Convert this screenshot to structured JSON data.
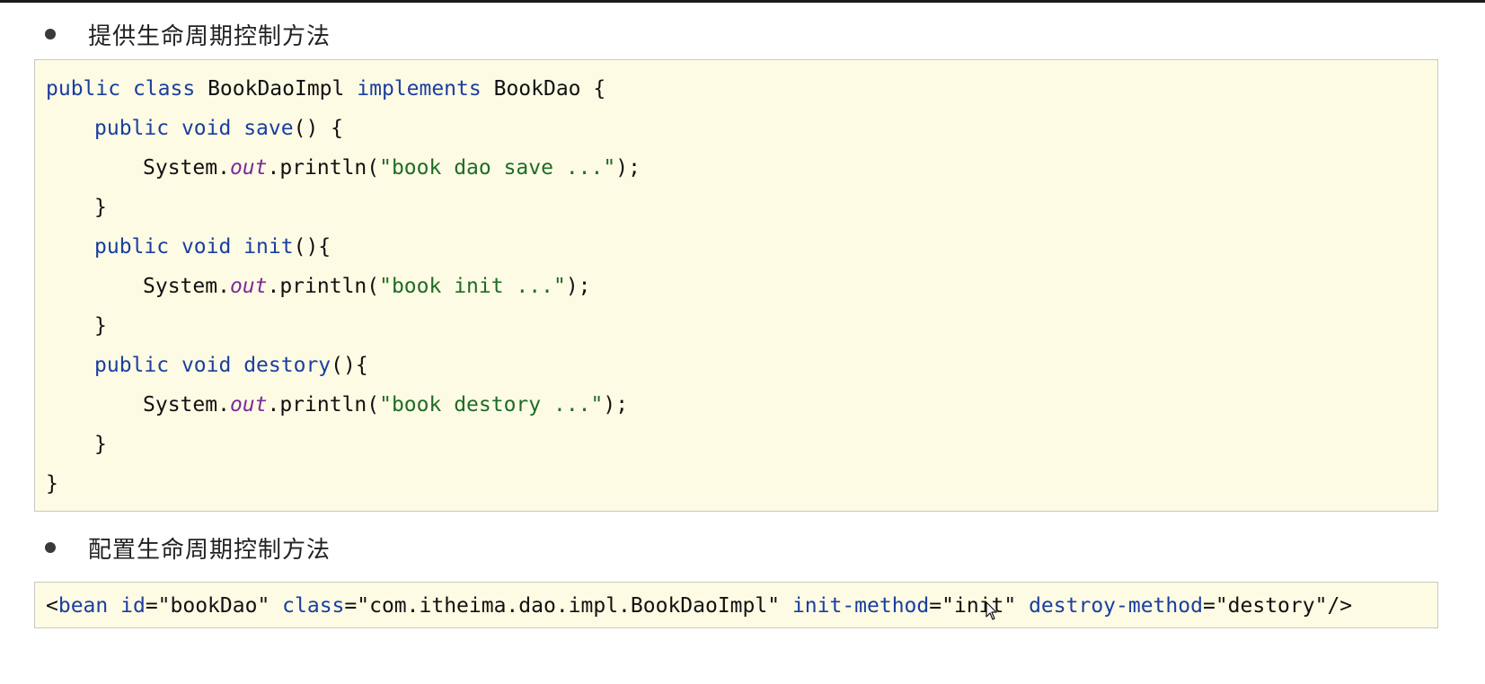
{
  "section1": {
    "heading": "提供生命周期控制方法"
  },
  "section2": {
    "heading": "配置生命周期控制方法"
  },
  "code1": {
    "l1_kw1": "public",
    "l1_kw2": "class",
    "l1_name": "BookDaoImpl",
    "l1_kw3": "implements",
    "l1_iface": "BookDao",
    "l1_brace": "{",
    "l2_kw1": "public",
    "l2_kw2": "void",
    "l2_fn": "save",
    "l2_rest": "() {",
    "l3_pre": "System.",
    "l3_out": "out",
    "l3_mid": ".println(",
    "l3_str": "\"book dao save ...\"",
    "l3_end": ");",
    "l4": "}",
    "l5_kw1": "public",
    "l5_kw2": "void",
    "l5_fn": "init",
    "l5_rest": "(){",
    "l6_pre": "System.",
    "l6_out": "out",
    "l6_mid": ".println(",
    "l6_str": "\"book init ...\"",
    "l6_end": ");",
    "l7": "}",
    "l8_kw1": "public",
    "l8_kw2": "void",
    "l8_fn": "destory",
    "l8_rest": "(){",
    "l9_pre": "System.",
    "l9_out": "out",
    "l9_mid": ".println(",
    "l9_str": "\"book destory ...\"",
    "l9_end": ");",
    "l10": "}",
    "l11": "}"
  },
  "code2": {
    "open": "<",
    "tag": "bean",
    "a1": "id",
    "v1": "\"bookDao\"",
    "a2": "class",
    "v2": "\"com.itheima.dao.impl.BookDaoImpl\"",
    "a3": "init-method",
    "v3": "\"init\"",
    "a4": "destroy-method",
    "v4": "\"destory\"",
    "close": "/>"
  },
  "colors": {
    "keyword": "#1a3ea0",
    "string": "#1f6b27",
    "field": "#7a2a9c",
    "code_background": "#fdfbe4"
  },
  "icons": {
    "bullet": "bullet-dot-icon",
    "cursor": "mouse-pointer-icon"
  }
}
